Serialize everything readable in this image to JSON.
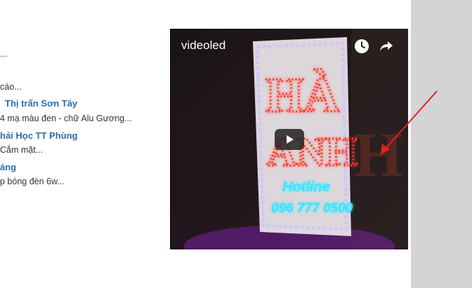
{
  "fragments": [
    {
      "text": "..."
    },
    {
      "text": "cáo..."
    },
    {
      "text": "Thị trấn Sơn Tây",
      "link": true
    },
    {
      "text": "4 mạ màu đen - chữ Alu Gương..."
    },
    {
      "text": "hải Học TT Phùng",
      "link": true
    },
    {
      "text": "Cắm mặt..."
    },
    {
      "text": "áng",
      "link": true
    },
    {
      "text": "p bóng đèn 6w..."
    }
  ],
  "video": {
    "title": "videoled",
    "sign_line1": "HÀ",
    "sign_line2": "ANH",
    "hotline_label": "Hotline",
    "hotline_number": "096 777 0500",
    "icons": [
      "clock-icon",
      "share-icon",
      "play-icon"
    ]
  },
  "colors": {
    "link": "#2a6db3",
    "panel": "#d4d4d4",
    "neon_red": "#ff3a2a",
    "neon_cyan": "#39e6ff",
    "annotation_arrow": "#e02020"
  }
}
